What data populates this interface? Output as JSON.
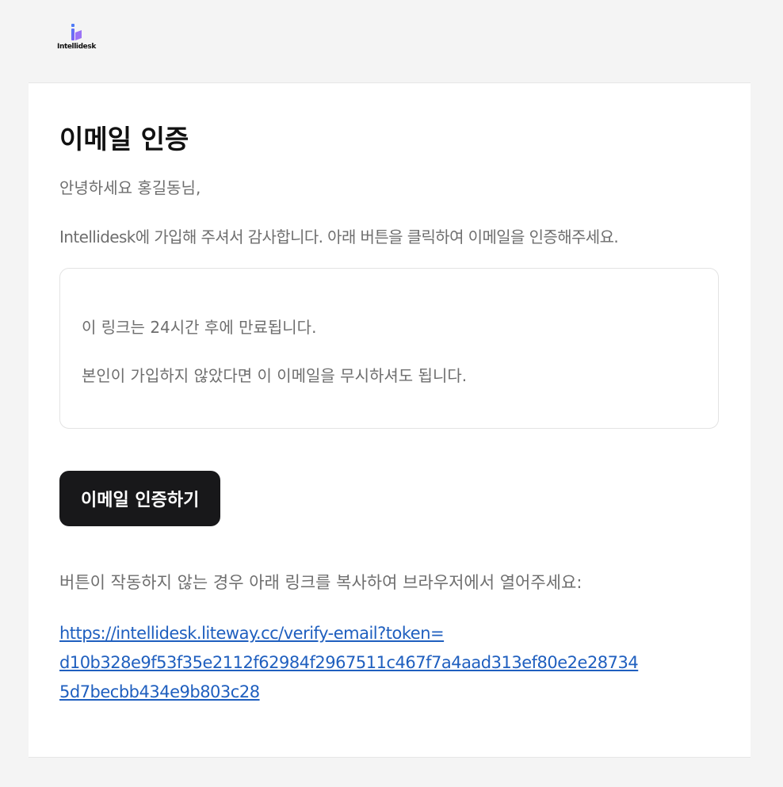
{
  "brand": {
    "name": "Intellidesk",
    "colors": {
      "mark_top": "#4f7cf7",
      "mark_bottom": "#8b5cf6"
    }
  },
  "email": {
    "title": "이메일 인증",
    "greeting": "안녕하세요 홍길동님,",
    "intro": "Intellidesk에 가입해 주셔서 감사합니다. 아래 버튼을 클릭하여 이메일을 인증해주세요.",
    "notice": {
      "expiry": "이 링크는 24시간 후에 만료됩니다.",
      "ignore": "본인이 가입하지 않았다면 이 이메일을 무시하셔도 됩니다."
    },
    "button_label": "이메일 인증하기",
    "fallback_text": "버튼이 작동하지 않는 경우 아래 링크를 복사하여 브라우저에서 열어주세요:",
    "verify_link": {
      "line1": "https://intellidesk.liteway.cc/verify-email?token=",
      "line2": "d10b328e9f53f35e2112f62984f2967511c467f7a4aad313ef80e2e28734",
      "line3": "5d7becbb434e9b803c28"
    }
  },
  "colors": {
    "page_bg": "#f4f4f4",
    "card_bg": "#ffffff",
    "button_bg": "#18181a",
    "link": "#1f5fbf",
    "body_text": "#6e6e6e"
  }
}
